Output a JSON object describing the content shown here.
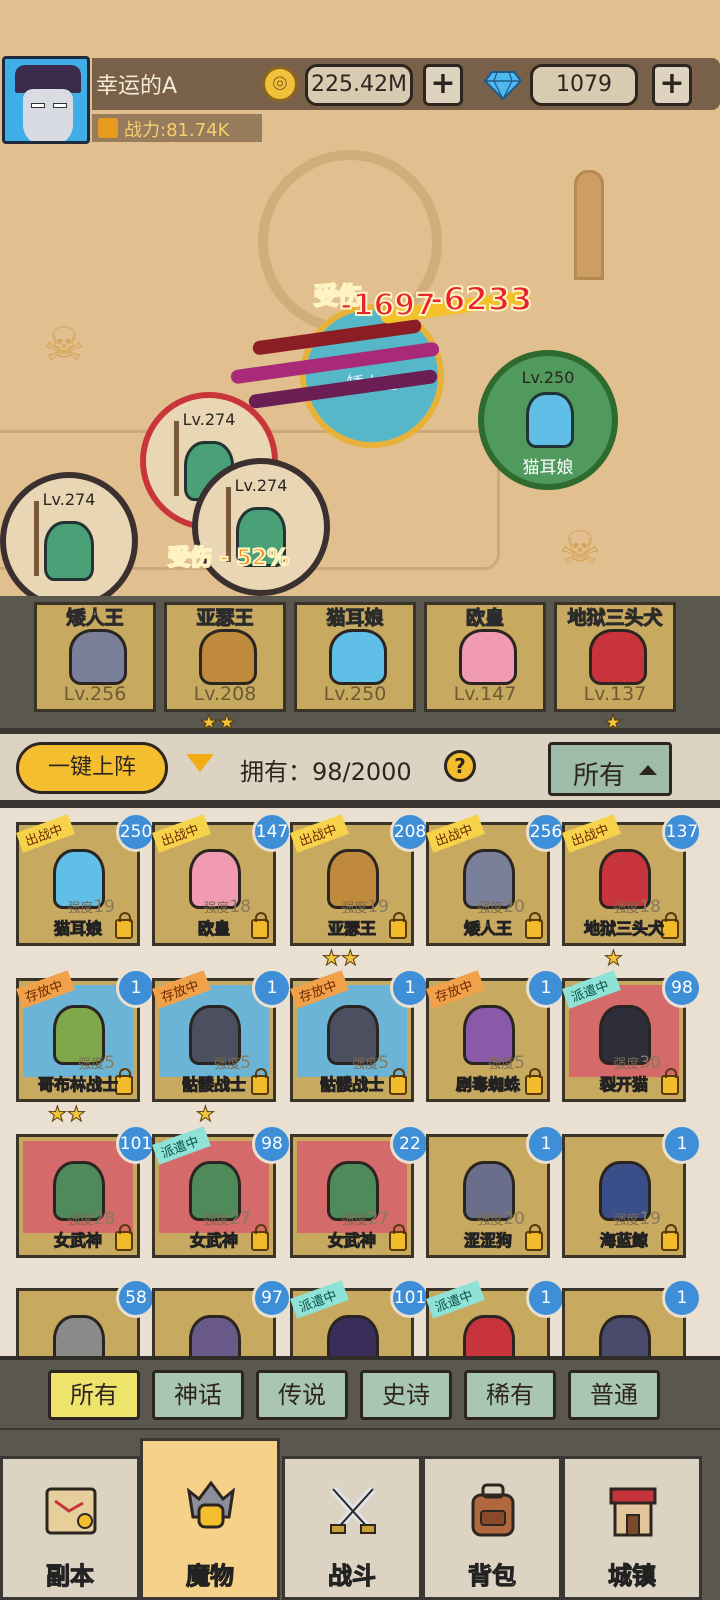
{
  "header": {
    "player_name": "幸运的A",
    "power": "战力:81.74K",
    "gold": "225.42M",
    "gems": "1079",
    "plus": "+"
  },
  "battle": {
    "units": [
      {
        "level": "Lv.250",
        "name": "猫耳娘"
      },
      {
        "level": "Lv.274"
      },
      {
        "level": "Lv.274"
      },
      {
        "level": "Lv.274"
      }
    ],
    "boss_name": "矮人王",
    "damage_label": "受伤",
    "damage_1": "-1697",
    "damage_2": "-6233",
    "damage_label_2": "受伤 - 52%"
  },
  "deployed": [
    {
      "name": "矮人王",
      "level": "Lv.256",
      "color": "#7a7f9a"
    },
    {
      "name": "亚瑟王",
      "level": "Lv.208",
      "color": "#c08a3c"
    },
    {
      "name": "猫耳娘",
      "level": "Lv.250",
      "color": "#5fbfe6"
    },
    {
      "name": "欧皇",
      "level": "Lv.147",
      "color": "#f19bb2"
    },
    {
      "name": "地狱三头犬",
      "level": "Lv.137",
      "color": "#c8343c"
    }
  ],
  "deployed_stars": [
    "★★",
    "★"
  ],
  "controls": {
    "deploy_all": "一键上阵",
    "owned": "拥有：98/2000",
    "help": "?",
    "filter": "所有"
  },
  "roster": [
    {
      "name": "猫耳娘",
      "level": "250",
      "strength": "19",
      "status": "出战中",
      "bg": "#c8a960",
      "color": "#5fbfe6"
    },
    {
      "name": "欧皇",
      "level": "147",
      "strength": "18",
      "status": "出战中",
      "bg": "#c8a960",
      "color": "#f19bb2"
    },
    {
      "name": "亚瑟王",
      "level": "208",
      "strength": "19",
      "status": "出战中",
      "bg": "#c8a960",
      "color": "#c08a3c"
    },
    {
      "name": "矮人王",
      "level": "256",
      "strength": "20",
      "status": "出战中",
      "bg": "#c8a960",
      "color": "#7a7f9a"
    },
    {
      "name": "地狱三头犬",
      "level": "137",
      "strength": "18",
      "status": "出战中",
      "bg": "#c8a960",
      "color": "#c8343c"
    },
    {
      "name": "哥布林战士",
      "level": "1",
      "strength": "5",
      "status": "存放中",
      "bg": "#6bb4d6",
      "color": "#7fa84a"
    },
    {
      "name": "骷髅战士",
      "level": "1",
      "strength": "5",
      "status": "存放中",
      "bg": "#6bb4d6",
      "color": "#4b4f60"
    },
    {
      "name": "骷髅战士",
      "level": "1",
      "strength": "5",
      "status": "存放中",
      "bg": "#6bb4d6",
      "color": "#4b4f60"
    },
    {
      "name": "剧毒蜘蛛",
      "level": "1",
      "strength": "5",
      "status": "存放中",
      "bg": "#c8a960",
      "color": "#8a5aa8"
    },
    {
      "name": "裂开猫",
      "level": "98",
      "strength": "30",
      "status": "派遣中",
      "bg": "#d46a6a",
      "color": "#2e2e3a"
    },
    {
      "name": "女武神",
      "level": "101",
      "strength": "28",
      "status": "",
      "bg": "#d46a6a",
      "color": "#4e8a5a"
    },
    {
      "name": "女武神",
      "level": "98",
      "strength": "27",
      "status": "派遣中",
      "bg": "#d46a6a",
      "color": "#4e8a5a"
    },
    {
      "name": "女武神",
      "level": "22",
      "strength": "27",
      "status": "",
      "bg": "#d46a6a",
      "color": "#4e8a5a"
    },
    {
      "name": "涩涩狗",
      "level": "1",
      "strength": "20",
      "status": "",
      "bg": "#c8a960",
      "color": "#6a6e8a"
    },
    {
      "name": "海蓝鲸",
      "level": "1",
      "strength": "19",
      "status": "",
      "bg": "#c8a960",
      "color": "#3a4f8a"
    },
    {
      "name": "",
      "level": "58",
      "strength": "",
      "status": "",
      "bg": "#c8a960",
      "color": "#8a8a8a"
    },
    {
      "name": "",
      "level": "97",
      "strength": "",
      "status": "",
      "bg": "#c8a960",
      "color": "#6a5a8a"
    },
    {
      "name": "",
      "level": "101",
      "strength": "",
      "status": "派遣中",
      "bg": "#c8a960",
      "color": "#3a2e5a"
    },
    {
      "name": "",
      "level": "1",
      "strength": "",
      "status": "派遣中",
      "bg": "#c8a960",
      "color": "#c8343c"
    },
    {
      "name": "",
      "level": "1",
      "strength": "",
      "status": "",
      "bg": "#c8a960",
      "color": "#4a4a6a"
    }
  ],
  "strength_label": "强度",
  "row_stars": [
    "★★",
    "★",
    "★★",
    "★"
  ],
  "rarity_tabs": [
    "所有",
    "神话",
    "传说",
    "史诗",
    "稀有",
    "普通"
  ],
  "nav": [
    {
      "label": "副本",
      "icon": "map-icon"
    },
    {
      "label": "魔物",
      "icon": "monster-icon"
    },
    {
      "label": "战斗",
      "icon": "swords-icon"
    },
    {
      "label": "背包",
      "icon": "backpack-icon"
    },
    {
      "label": "城镇",
      "icon": "town-icon"
    }
  ],
  "colors": {
    "accent": "#f5be2f",
    "level_badge": "#3f8fd8",
    "tab_active": "#efe46b",
    "tab": "#a9c5b4"
  }
}
